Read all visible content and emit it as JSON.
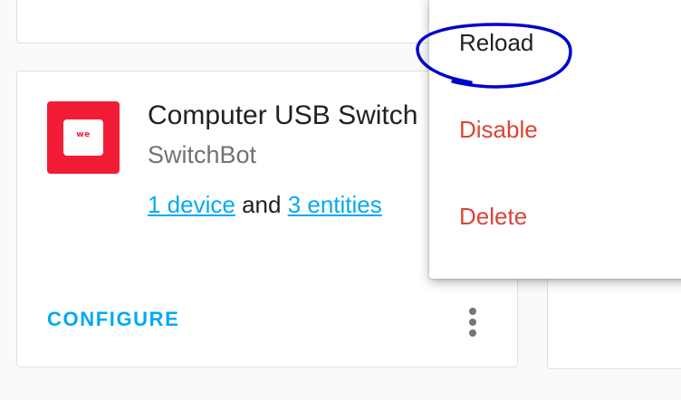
{
  "integration": {
    "logo_text": "we",
    "title": "Computer USB Switch",
    "manufacturer": "SwitchBot",
    "devices_link": "1 device",
    "connector": "and",
    "entities_link": "3 entities",
    "configure_label": "CONFIGURE",
    "overflow_icon": "more-vertical-icon"
  },
  "overflow_menu": {
    "items": [
      {
        "label": "Reload",
        "color": "#212121"
      },
      {
        "label": "Disable",
        "color": "#db4437"
      },
      {
        "label": "Delete",
        "color": "#db4437"
      }
    ]
  },
  "colors": {
    "accent": "#03a9f4",
    "brand": "#f21c36",
    "danger": "#db4437",
    "annotation": "#0000cc"
  }
}
